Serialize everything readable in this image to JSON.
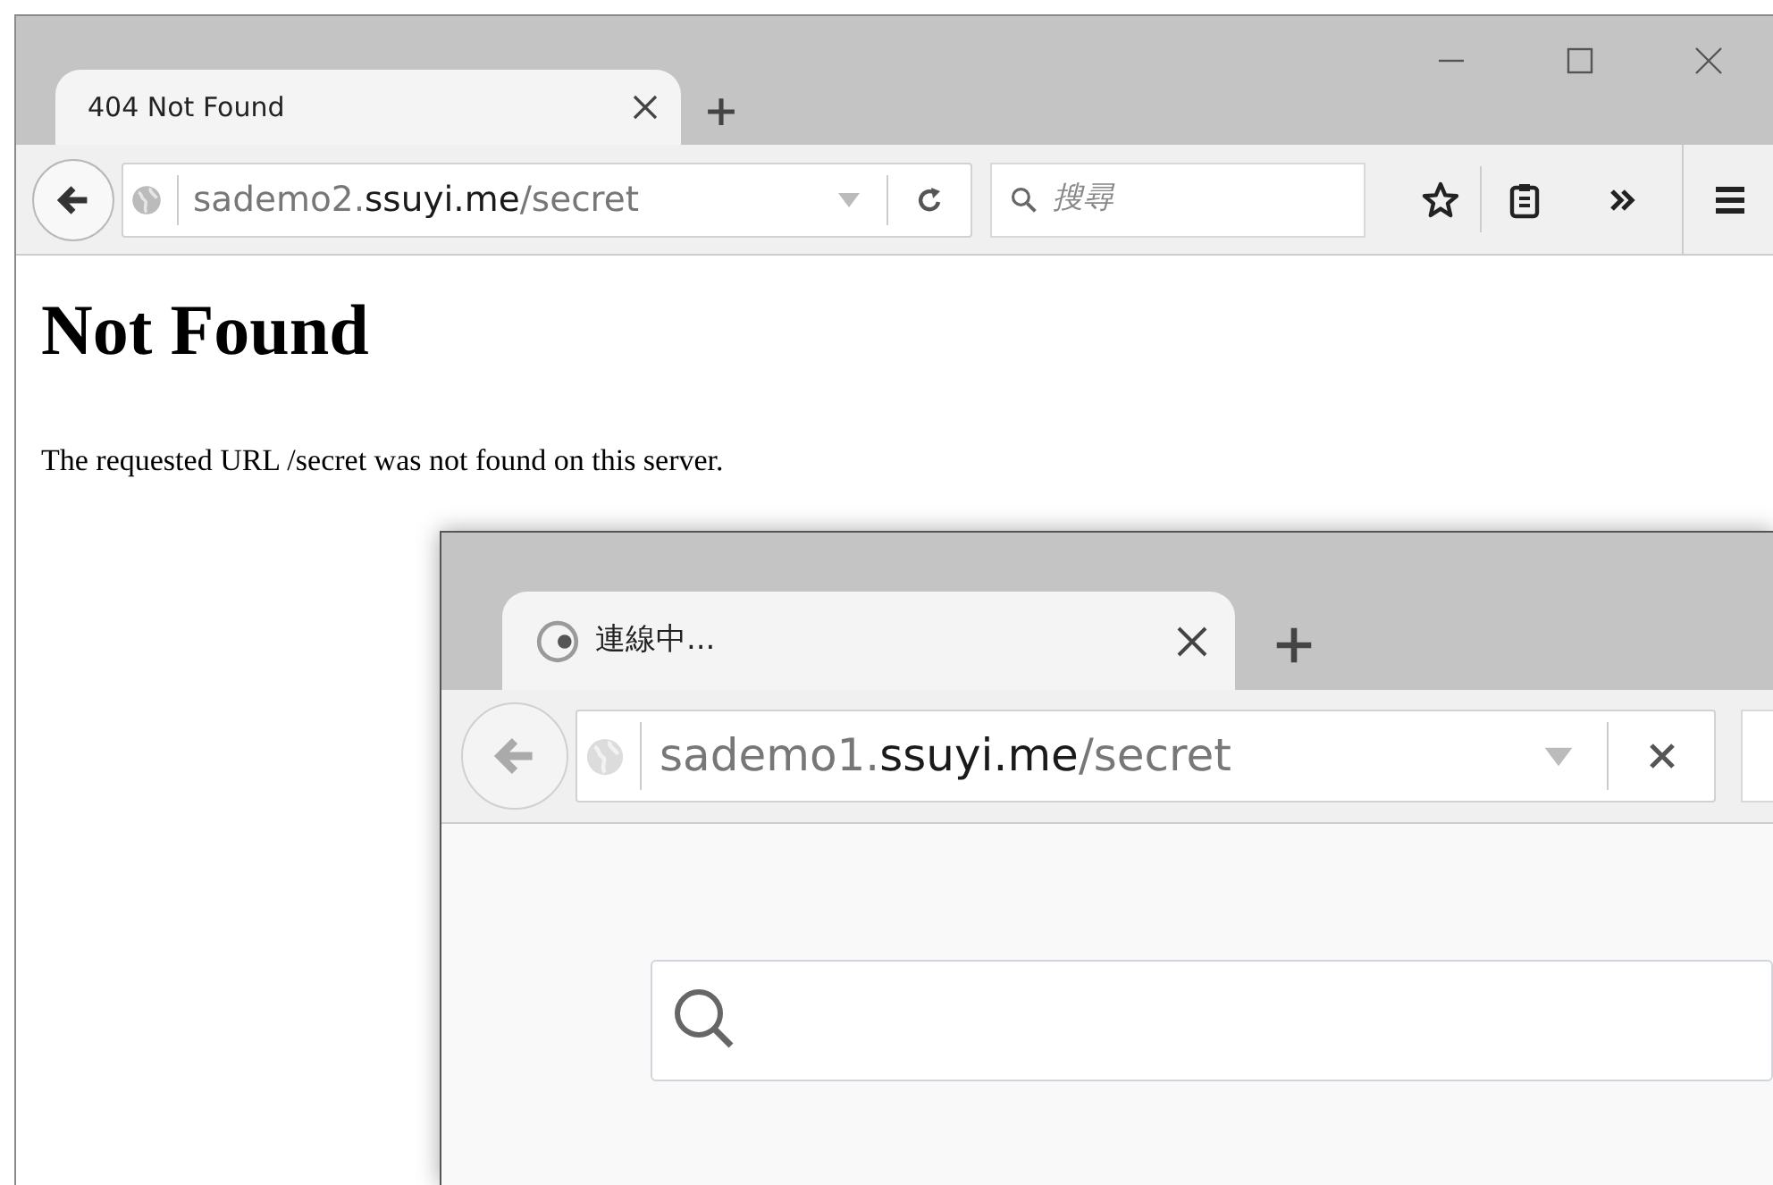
{
  "back_window": {
    "tab": {
      "title": "404 Not Found",
      "loading": false
    },
    "back_enabled": true,
    "url": [
      {
        "text": "sademo2.",
        "kind": "dim"
      },
      {
        "text": "ssuyi.me",
        "kind": "host"
      },
      {
        "text": "/secret",
        "kind": "dim"
      }
    ],
    "address_button": {
      "kind": "reload"
    },
    "search": {
      "placeholder": "搜尋"
    },
    "page": {
      "heading": "Not Found",
      "text": "The requested URL /secret was not found on this server."
    }
  },
  "front_window": {
    "tab": {
      "title": "連線中...",
      "loading": true
    },
    "back_enabled": false,
    "url": [
      {
        "text": "sademo1.",
        "kind": "dim"
      },
      {
        "text": "ssuyi.me",
        "kind": "host"
      },
      {
        "text": "/secret",
        "kind": "dim"
      }
    ],
    "address_button": {
      "kind": "stop"
    }
  }
}
